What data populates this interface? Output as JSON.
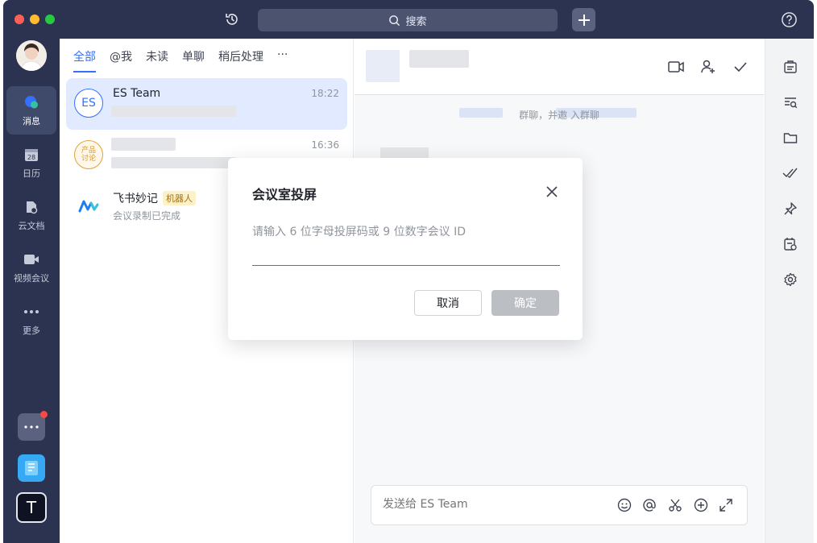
{
  "titlebar": {
    "search_label": "搜索"
  },
  "nav": {
    "items": [
      {
        "label": "消息"
      },
      {
        "label": "日历",
        "day": "28"
      },
      {
        "label": "云文档"
      },
      {
        "label": "视频会议"
      },
      {
        "label": "更多"
      }
    ],
    "dock_app_letter": "T"
  },
  "chatlist": {
    "tabs": [
      "全部",
      "@我",
      "未读",
      "单聊",
      "稍后处理",
      "···"
    ],
    "chats": [
      {
        "avatar_text": "ES",
        "name": "ES Team",
        "time": "18:22"
      },
      {
        "avatar_text": "产品讨论",
        "name": "",
        "time": "16:36"
      },
      {
        "name": "飞书妙记",
        "badge": "机器人",
        "preview": "会议录制已完成"
      }
    ]
  },
  "chat": {
    "system_message": "群聊，并邀 入群聊",
    "composer_placeholder": "发送给 ES Team"
  },
  "modal": {
    "title": "会议室投屏",
    "input_placeholder": "请输入 6 位字母投屏码或 9 位数字会议 ID",
    "cancel_label": "取消",
    "ok_label": "确定"
  },
  "colors": {
    "accent": "#3370ff",
    "sidebar_bg": "#2b3350",
    "badge_red": "#f54a45"
  }
}
